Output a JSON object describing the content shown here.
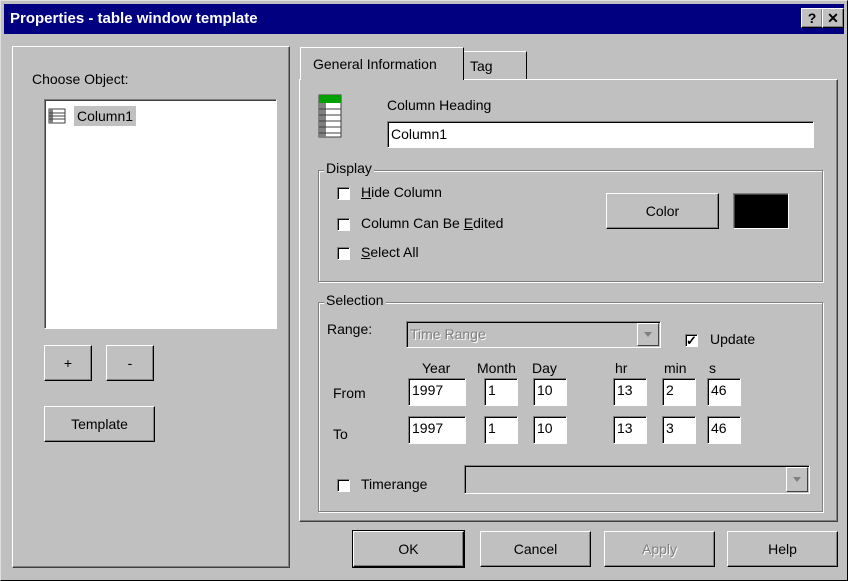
{
  "window": {
    "title": "Properties - table window template",
    "help_glyph": "?",
    "close_glyph": "✕"
  },
  "left": {
    "choose_label": "Choose Object:",
    "objects": [
      "Column1"
    ],
    "add_label": "+",
    "remove_label": "-",
    "template_label": "Template"
  },
  "tabs": [
    {
      "label": "General Information",
      "active": true
    },
    {
      "label": "Tag",
      "active": false
    }
  ],
  "general": {
    "heading_label": "Column Heading",
    "heading_value": "Column1",
    "display": {
      "label": "Display",
      "hide_column": {
        "pre": "",
        "u": "H",
        "post": "ide Column",
        "checked": false
      },
      "editable": {
        "pre": "Column Can Be ",
        "u": "E",
        "post": "dited",
        "checked": false
      },
      "select_all": {
        "pre": "",
        "u": "S",
        "post": "elect All",
        "checked": false
      },
      "color_label": "Color",
      "swatch_color": "#000000"
    },
    "selection": {
      "label": "Selection",
      "range_label": "Range:",
      "range_value": "Time Range",
      "update_label": "Update",
      "update_checked": true,
      "headers": {
        "year": "Year",
        "month": "Month",
        "day": "Day",
        "hr": "hr",
        "min": "min",
        "s": "s"
      },
      "from_label": "From",
      "to_label": "To",
      "from": {
        "year": "1997",
        "month": "1",
        "day": "10",
        "hr": "13",
        "min": "2",
        "s": "46"
      },
      "to": {
        "year": "1997",
        "month": "1",
        "day": "10",
        "hr": "13",
        "min": "3",
        "s": "46"
      },
      "timerange_label": "Timerange",
      "timerange_checked": false,
      "timerange_value": ""
    }
  },
  "footer": {
    "ok": "OK",
    "cancel": "Cancel",
    "apply": "Apply",
    "help": "Help"
  },
  "colors": {
    "titlebar": "#000080",
    "face": "#c0c0c0",
    "selection": "#c0c0c0"
  }
}
